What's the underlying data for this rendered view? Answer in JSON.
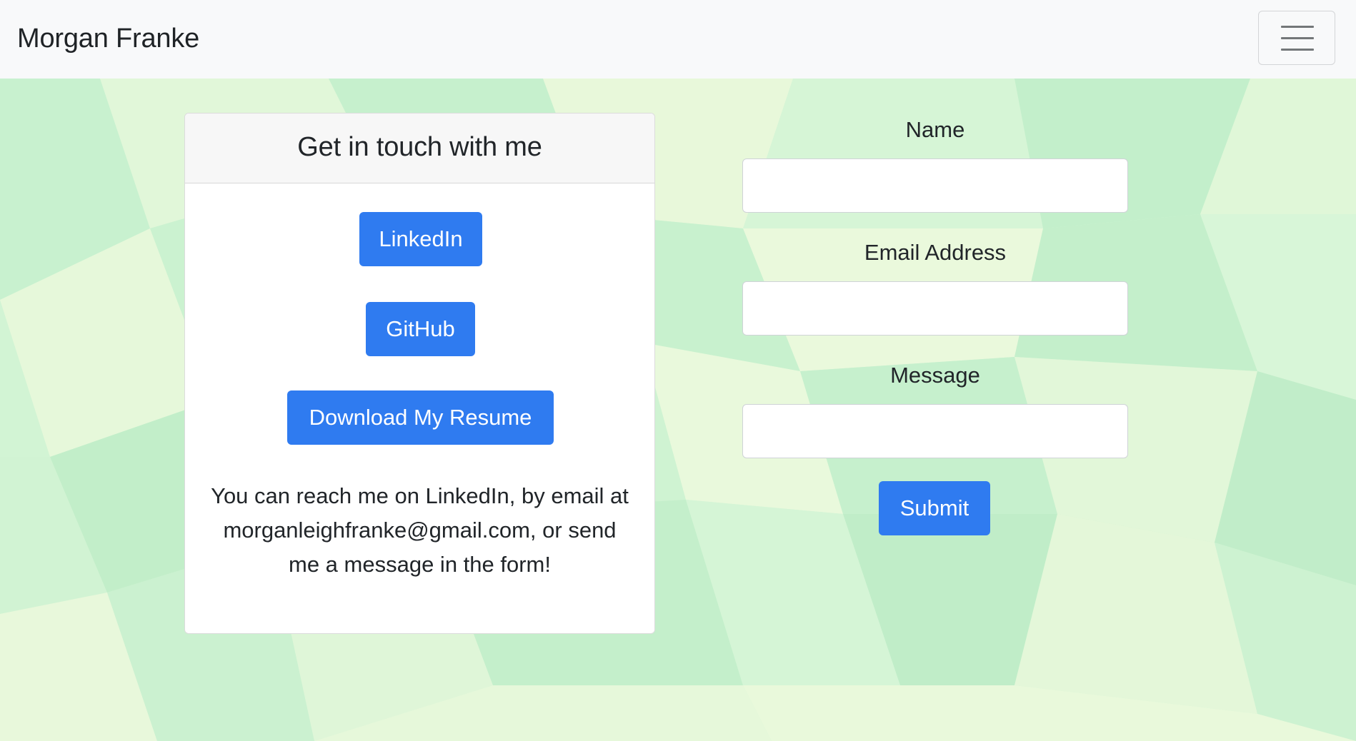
{
  "navbar": {
    "brand": "Morgan Franke",
    "toggle_icon": "hamburger-menu-icon"
  },
  "contact_card": {
    "title": "Get in touch with me",
    "buttons": {
      "linkedin": "LinkedIn",
      "github": "GitHub",
      "resume": "Download My Resume"
    },
    "text": "You can reach me on LinkedIn, by email at morganleighfranke@gmail.com, or send me a message in the form!"
  },
  "form": {
    "name_label": "Name",
    "name_value": "",
    "email_label": "Email Address",
    "email_value": "",
    "message_label": "Message",
    "message_value": "",
    "submit_label": "Submit"
  },
  "colors": {
    "primary_button": "#2f7bf0",
    "navbar_background": "#f8f9fa",
    "background_greens": [
      "#c9f3d0",
      "#e3f7d8",
      "#bdeec9",
      "#eef9d6"
    ]
  }
}
